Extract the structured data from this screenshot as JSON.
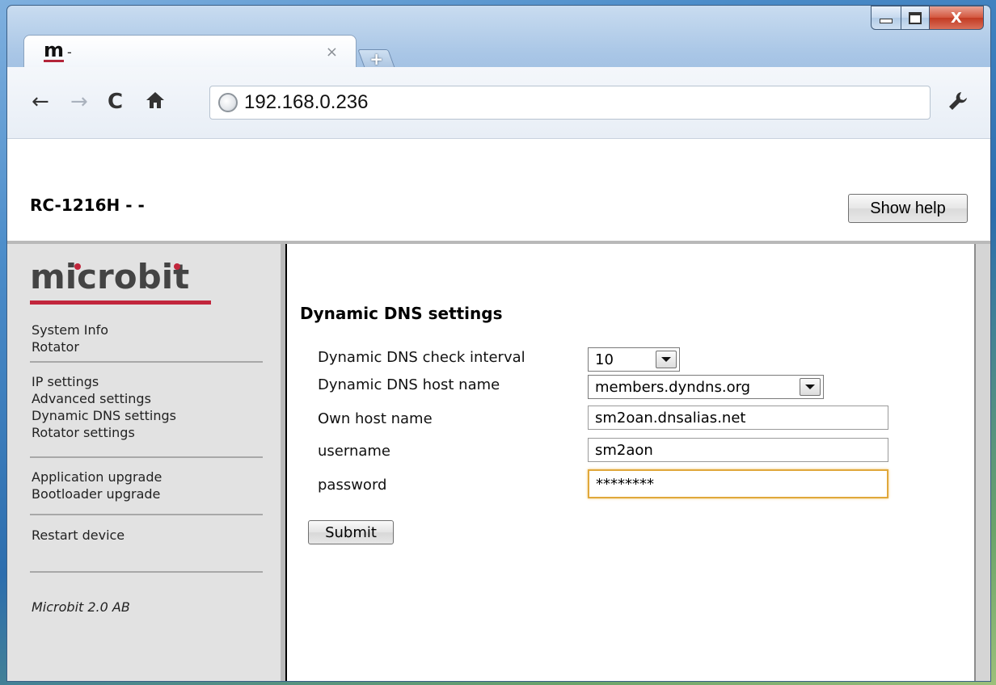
{
  "browser": {
    "tab": {
      "favicon_letter": "m",
      "title": "-"
    },
    "new_tab_symbol": "+",
    "close_tab_symbol": "×",
    "address": "192.168.0.236",
    "nav_icons": {
      "back": "←",
      "forward": "→",
      "reload": "C",
      "home": "⌂",
      "wrench": "wrench-icon"
    },
    "window_close_symbol": "X"
  },
  "header": {
    "device_name": "RC-1216H - -",
    "help_button": "Show help"
  },
  "sidebar": {
    "logo": "microbit",
    "group1": [
      "System Info",
      "Rotator"
    ],
    "group2": [
      "IP settings",
      "Advanced settings",
      "Dynamic DNS settings",
      "Rotator settings"
    ],
    "group3": [
      "Application upgrade",
      "Bootloader upgrade"
    ],
    "group4": [
      "Restart device"
    ],
    "footer": "Microbit 2.0 AB"
  },
  "form": {
    "title": "Dynamic DNS settings",
    "fields": {
      "interval_label": "Dynamic DNS check interval",
      "interval_value": "10",
      "host_label": "Dynamic DNS host name",
      "host_value": "members.dyndns.org",
      "own_host_label": "Own host name",
      "own_host_value": "sm2oan.dnsalias.net",
      "username_label": "username",
      "username_value": "sm2aon",
      "password_label": "password",
      "password_value": "********"
    },
    "submit": "Submit"
  },
  "colors": {
    "brand_red": "#c2263c",
    "focus_border": "#e0a83b"
  }
}
